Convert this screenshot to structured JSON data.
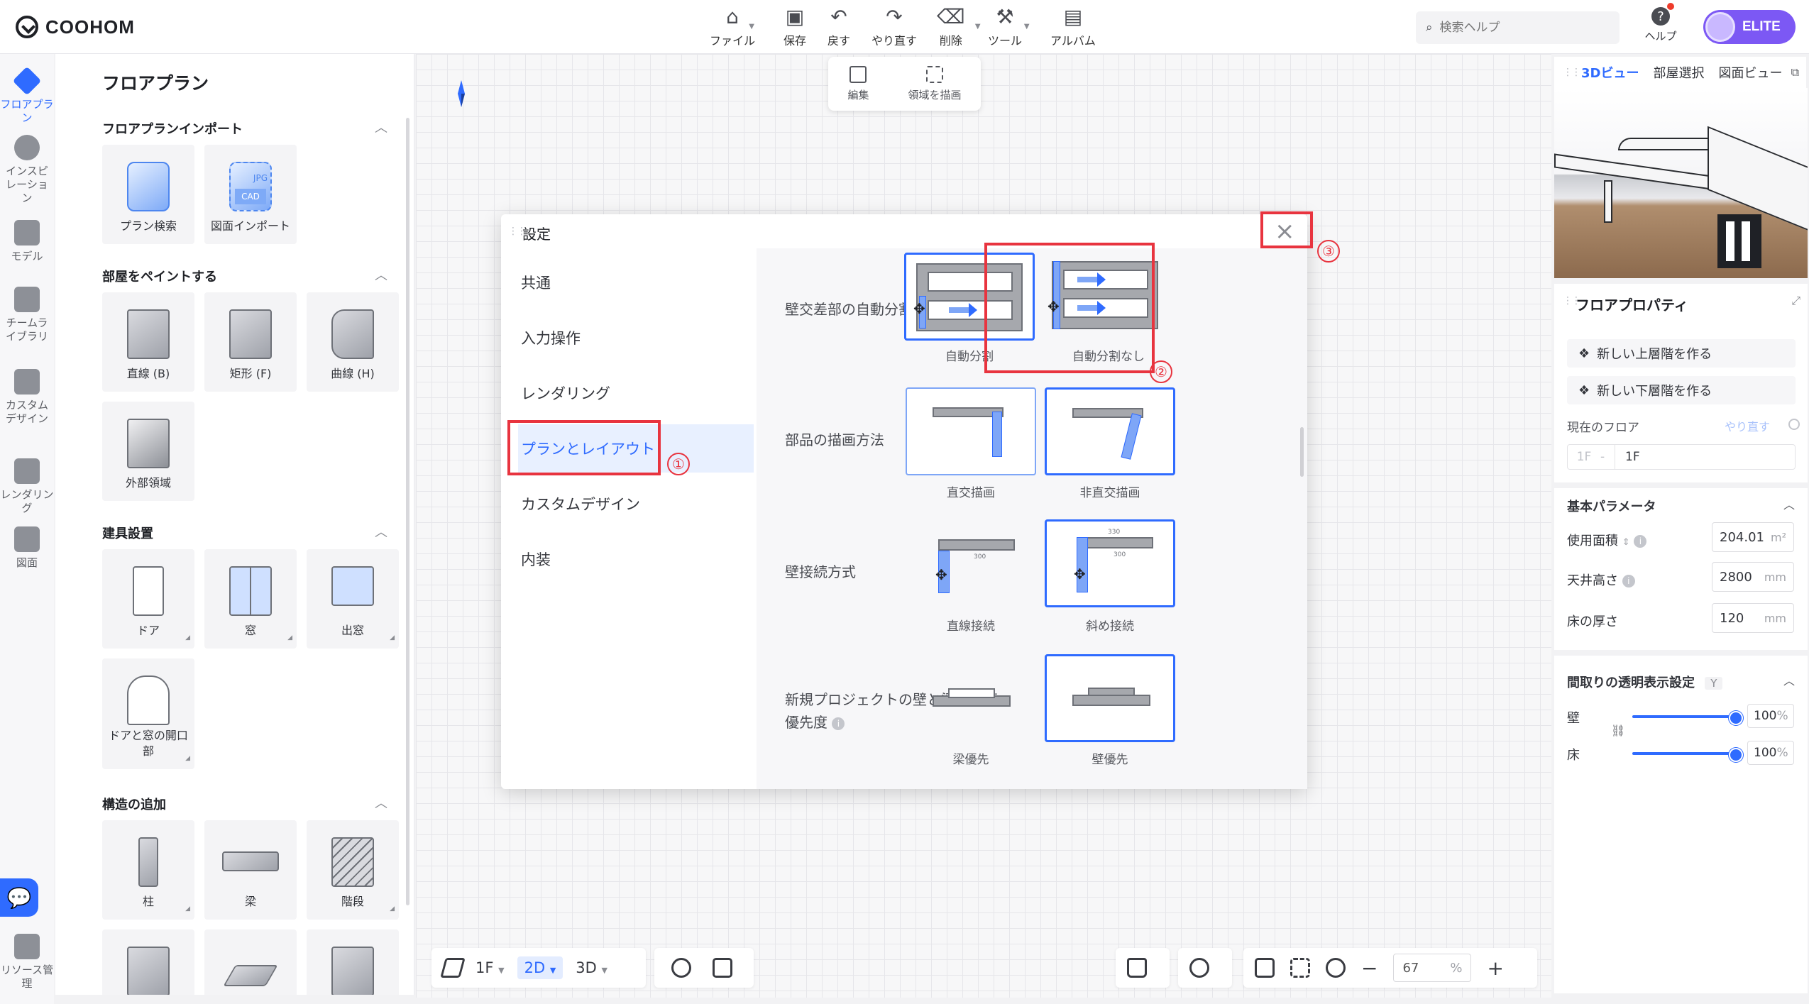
{
  "app": {
    "logo_text": "COOHOM",
    "toolbar": [
      {
        "label": "ファイル",
        "icon": "house-icon"
      },
      {
        "label": "保存",
        "icon": "save-icon"
      },
      {
        "label": "戻す",
        "icon": "undo-icon"
      },
      {
        "label": "やり直す",
        "icon": "redo-icon"
      },
      {
        "label": "削除",
        "icon": "eraser-icon"
      },
      {
        "label": "ツール",
        "icon": "wrench-icon"
      },
      {
        "label": "アルバム",
        "icon": "album-icon"
      }
    ],
    "search_placeholder": "検索ヘルプ",
    "help_label": "ヘルプ",
    "plan_badge": "ELITE"
  },
  "rail": [
    {
      "label": "フロアプラン",
      "active": true
    },
    {
      "label": "インスピレーション",
      "active": false
    },
    {
      "label": "モデル",
      "active": false
    },
    {
      "label": "チームライブラリ",
      "active": false
    },
    {
      "label": "カスタムデザイン",
      "active": false
    },
    {
      "label": "レンダリング",
      "active": false
    },
    {
      "label": "図面",
      "active": false
    },
    {
      "label": "リソース管理",
      "active": false
    }
  ],
  "catalog": {
    "title": "フロアプラン",
    "sections": {
      "import": {
        "title": "フロアプランインポート",
        "items": [
          "プラン検索",
          "図面インポート"
        ]
      },
      "paint": {
        "title": "部屋をペイントする",
        "items": [
          "直線 (B)",
          "矩形 (F)",
          "曲線 (H)",
          "外部領域"
        ]
      },
      "fixtures": {
        "title": "建具設置",
        "items": [
          "ドア",
          "窓",
          "出窓",
          "ドアと窓の開口部"
        ]
      },
      "structure": {
        "title": "構造の追加",
        "items": [
          "柱",
          "梁",
          "階段"
        ]
      }
    },
    "cad_tags": {
      "jpg": "JPG",
      "cad": "CAD"
    }
  },
  "float_toolbar": {
    "edit": "編集",
    "draw_area": "領域を描画"
  },
  "dialog": {
    "title": "設定",
    "nav": [
      "共通",
      "入力操作",
      "レンダリング",
      "プランとレイアウト",
      "カスタムデザイン",
      "内装"
    ],
    "active_nav": "プランとレイアウト",
    "rows": {
      "auto_split": {
        "label": "壁交差部の自動分割",
        "options": [
          "自動分割",
          "自動分割なし"
        ],
        "selected": "自動分割"
      },
      "draw_method": {
        "label": "部品の描画方法",
        "options": [
          "直交描画",
          "非直交描画"
        ],
        "selected": "非直交描画"
      },
      "connection": {
        "label": "壁接続方式",
        "options": [
          "直線接続",
          "斜め接続"
        ],
        "selected": "斜め接続"
      },
      "priority": {
        "label": "新規プロジェクトの壁と梁の減算優先度",
        "options": [
          "梁優先",
          "壁優先"
        ],
        "selected": "壁優先"
      }
    },
    "dims": {
      "d300": "300",
      "d330": "330"
    },
    "annotations": [
      "①",
      "②",
      "③"
    ]
  },
  "bottom": {
    "floor": "1F",
    "view2d": "2D",
    "view3d": "3D",
    "zoom_value": "67",
    "zoom_unit": "%",
    "minus": "−",
    "plus": "+"
  },
  "right": {
    "tabs": [
      "3Dビュー",
      "部屋選択",
      "図面ビュー"
    ],
    "props_title": "フロアプロパティ",
    "new_upper": "新しい上層階を作る",
    "new_lower": "新しい下層階を作る",
    "current_floor_label": "現在のフロア",
    "redo": "やり直す",
    "floor_prefix": "1F",
    "floor_sep": "-",
    "floor_value": "1F",
    "basic_params": "基本パラメータ",
    "area_label": "使用面積",
    "area_value": "204.01",
    "area_unit": "m²",
    "ceiling_label": "天井高さ",
    "ceiling_value": "2800",
    "ceiling_unit": "mm",
    "floor_thick_label": "床の厚さ",
    "floor_thick_value": "120",
    "floor_thick_unit": "mm",
    "transparency_title": "間取りの透明表示設定",
    "transparency_key": "Y",
    "wall_label": "壁",
    "wall_value": "100",
    "floor_label": "床",
    "floor_pct": "100",
    "pct": "%"
  },
  "colors": {
    "accent": "#2f6bff",
    "annotation_red": "#e8343f",
    "badge": "#7c58f4"
  }
}
